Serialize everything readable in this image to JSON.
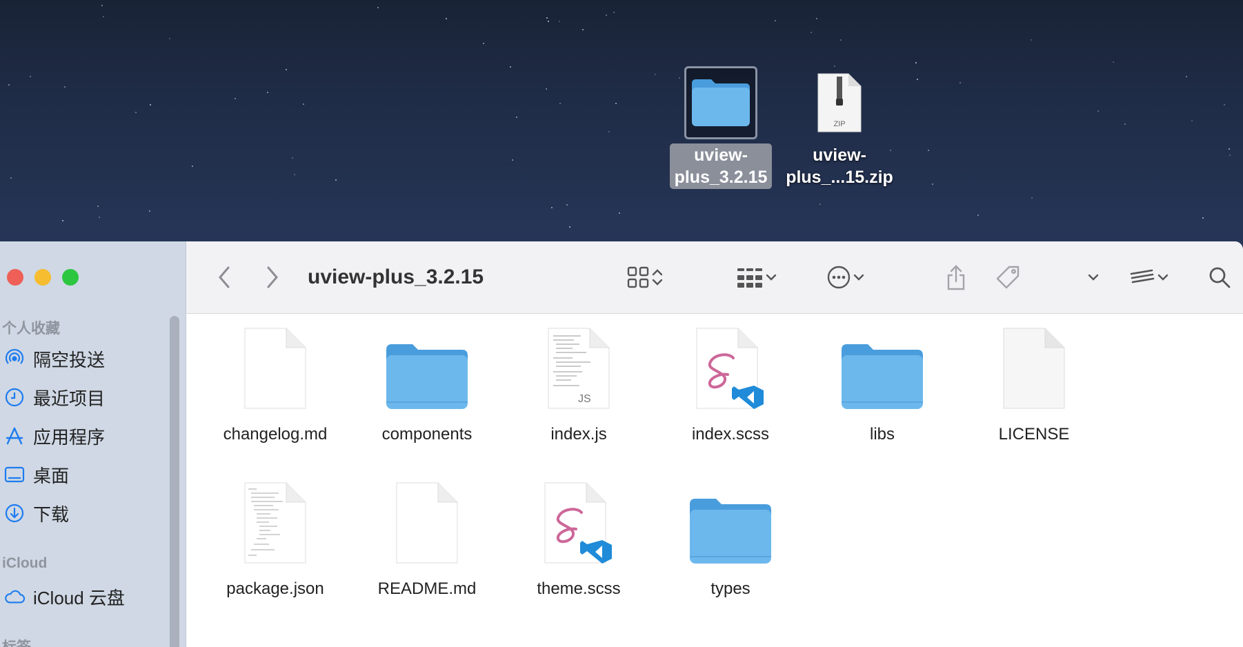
{
  "desktop": {
    "items": [
      {
        "name_line1": "uview-",
        "name_line2": "plus_3.2.15",
        "kind": "folder",
        "selected": true
      },
      {
        "name_line1": "uview-",
        "name_line2": "plus_...15.zip",
        "kind": "zip-archive",
        "badge": "ZIP",
        "selected": false
      }
    ]
  },
  "finder": {
    "title": "uview-plus_3.2.15",
    "toolbar": {
      "icons": [
        "back-chevron-icon",
        "forward-chevron-icon",
        "icon-view-grid-icon",
        "view-options-chevrons-icon",
        "group-by-icon",
        "more-actions-icon",
        "share-icon",
        "tag-icon",
        "dropdown-chevron-icon",
        "stage-manager-icon",
        "search-icon"
      ]
    },
    "sidebar": {
      "favorites_header": "个人收藏",
      "favorites": [
        {
          "label": "隔空投送",
          "icon": "airdrop-icon"
        },
        {
          "label": "最近项目",
          "icon": "clock-icon"
        },
        {
          "label": "应用程序",
          "icon": "applications-icon"
        },
        {
          "label": "桌面",
          "icon": "desktop-icon"
        },
        {
          "label": "下载",
          "icon": "download-icon"
        }
      ],
      "icloud_header": "iCloud",
      "icloud": [
        {
          "label": "iCloud 云盘",
          "icon": "cloud-icon"
        }
      ],
      "tags_header": "标签"
    },
    "files": [
      {
        "name": "changelog.md",
        "type": "document"
      },
      {
        "name": "components",
        "type": "folder"
      },
      {
        "name": "index.js",
        "type": "javascript",
        "badge": "JS"
      },
      {
        "name": "index.scss",
        "type": "scss"
      },
      {
        "name": "libs",
        "type": "folder"
      },
      {
        "name": "LICENSE",
        "type": "document"
      },
      {
        "name": "package.json",
        "type": "json"
      },
      {
        "name": "README.md",
        "type": "document"
      },
      {
        "name": "theme.scss",
        "type": "scss"
      },
      {
        "name": "types",
        "type": "folder"
      }
    ]
  },
  "colors": {
    "folder": "#6cb8ec",
    "folder_tab": "#4a9ddd",
    "traffic_close": "#ee5f57",
    "traffic_min": "#f5bd2f",
    "traffic_max": "#2cc641",
    "sidebar_icon": "#1d7bf0",
    "sass_pink": "#cd6799",
    "vscode_blue": "#1f8bd9"
  }
}
